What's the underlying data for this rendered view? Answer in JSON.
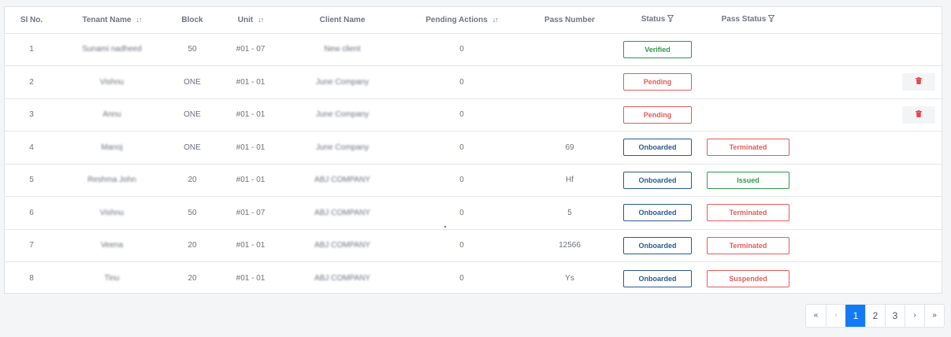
{
  "table": {
    "columns": {
      "sl_no": "Sl No.",
      "tenant_name": "Tenant Name",
      "block": "Block",
      "unit": "Unit",
      "client_name": "Client Name",
      "pending_actions": "Pending Actions",
      "pass_number": "Pass Number",
      "status": "Status",
      "pass_status": "Pass Status"
    },
    "rows": [
      {
        "sl": "1",
        "tenant": "Sunami nadheed",
        "block": "50",
        "unit": "#01 - 07",
        "client": "New client",
        "pending": "0",
        "pass_number": "",
        "status": "Verified",
        "status_color": "#2f9a4c",
        "pass_status": "",
        "pass_status_color": "",
        "delete": false
      },
      {
        "sl": "2",
        "tenant": "Vishnu",
        "block": "ONE",
        "unit": "#01 - 01",
        "client": "June Company",
        "pending": "0",
        "pass_number": "",
        "status": "Pending",
        "status_color": "#e55b5b",
        "pass_status": "",
        "pass_status_color": "",
        "delete": true
      },
      {
        "sl": "3",
        "tenant": "Annu",
        "block": "ONE",
        "unit": "#01 - 01",
        "client": "June Company",
        "pending": "0",
        "pass_number": "",
        "status": "Pending",
        "status_color": "#e55b5b",
        "pass_status": "",
        "pass_status_color": "",
        "delete": true
      },
      {
        "sl": "4",
        "tenant": "Manoj",
        "block": "ONE",
        "unit": "#01 - 01",
        "client": "June Company",
        "pending": "0",
        "pass_number": "69",
        "status": "Onboarded",
        "status_color": "#2c5a8e",
        "pass_status": "Terminated",
        "pass_status_color": "#e55b5b",
        "delete": false
      },
      {
        "sl": "5",
        "tenant": "Reshma John",
        "block": "20",
        "unit": "#01 - 01",
        "client": "ABJ COMPANY",
        "pending": "0",
        "pass_number": "Hf",
        "status": "Onboarded",
        "status_color": "#2c5a8e",
        "pass_status": "Issued",
        "pass_status_color": "#2f9a4c",
        "delete": false
      },
      {
        "sl": "6",
        "tenant": "Vishnu",
        "block": "50",
        "unit": "#01 - 07",
        "client": "ABJ COMPANY",
        "pending": "0",
        "pass_number": "5",
        "status": "Onboarded",
        "status_color": "#2c5a8e",
        "pass_status": "Terminated",
        "pass_status_color": "#e55b5b",
        "delete": false
      },
      {
        "sl": "7",
        "tenant": "Veena",
        "block": "20",
        "unit": "#01 - 01",
        "client": "ABJ COMPANY",
        "pending": "0",
        "pass_number": "12566",
        "status": "Onboarded",
        "status_color": "#2c5a8e",
        "pass_status": "Terminated",
        "pass_status_color": "#e55b5b",
        "delete": false
      },
      {
        "sl": "8",
        "tenant": "Tinu",
        "block": "20",
        "unit": "#01 - 01",
        "client": "ABJ COMPANY",
        "pending": "0",
        "pass_number": "Ys",
        "status": "Onboarded",
        "status_color": "#2c5a8e",
        "pass_status": "Suspended",
        "pass_status_color": "#e55b5b",
        "delete": false
      }
    ]
  },
  "pagination": {
    "first": "«",
    "prev": "‹",
    "pages": [
      "1",
      "2",
      "3"
    ],
    "active_page": "1",
    "next": "›",
    "last": "»"
  },
  "icons": {
    "sort": "sort-icon",
    "filter": "filter-icon",
    "delete": "trash-icon",
    "delete_color": "#e5484d"
  }
}
